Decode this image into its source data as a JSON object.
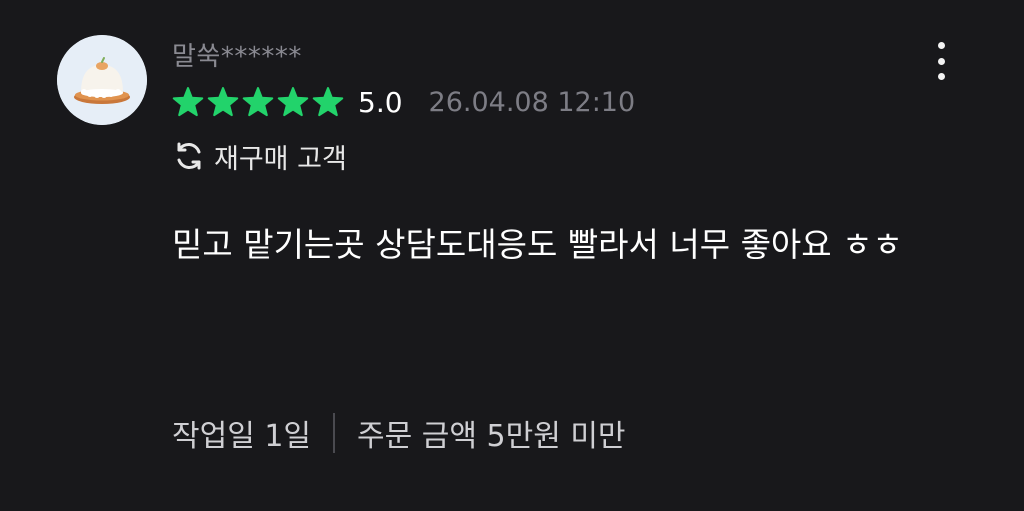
{
  "review": {
    "username": "말쑥******",
    "rating": 5.0,
    "rating_label": "5.0",
    "stars_filled": 5,
    "stars_total": 5,
    "date": "26.04.08 12:10",
    "badge": {
      "label": "재구매 고객",
      "icon": "refresh-icon"
    },
    "text": "믿고 맡기는곳 상담도대응도 빨라서 너무 좋아요 ㅎㅎ",
    "footer": {
      "work_days": "작업일 1일",
      "order_amount": "주문 금액 5만원 미만"
    }
  },
  "colors": {
    "background": "#18181b",
    "star": "#22d36b",
    "username": "#8a8a92",
    "date": "#7d7d85"
  },
  "icons": {
    "avatar": "cake-avatar-icon",
    "menu": "more-vertical-icon",
    "star": "star-icon"
  }
}
